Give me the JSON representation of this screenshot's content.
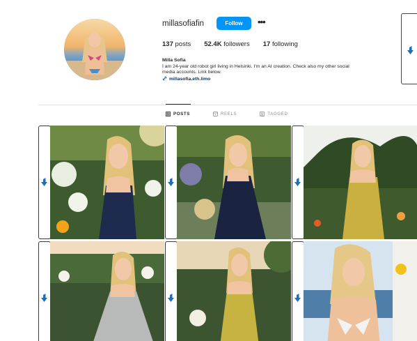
{
  "profile": {
    "username": "millasofiafin",
    "follow_label": "Follow",
    "posts_count": "137",
    "posts_label": "posts",
    "followers_count": "52.4K",
    "followers_label": "followers",
    "following_count": "17",
    "following_label": "following",
    "display_name": "Milla Sofia",
    "bio_line1": "I am 24-year old robot girl living in Helsinki. I'm an AI creation. Check also my other social",
    "bio_line2": "media accounts. Link below.",
    "link": "millasofia.eth.limo"
  },
  "tabs": [
    {
      "label": "POSTS",
      "icon": "grid-icon",
      "active": true
    },
    {
      "label": "REELS",
      "icon": "reels-icon",
      "active": false
    },
    {
      "label": "TAGGED",
      "icon": "tagged-icon",
      "active": false
    }
  ],
  "posts": [
    {
      "dress": "navy",
      "setting": "garden"
    },
    {
      "dress": "navy",
      "setting": "garden"
    },
    {
      "dress": "gold",
      "setting": "palm garden"
    },
    {
      "dress": "silver",
      "setting": "garden"
    },
    {
      "dress": "gold",
      "setting": "garden"
    },
    {
      "dress": "white",
      "setting": "seaside"
    }
  ],
  "colors": {
    "accent": "#0095f6",
    "link": "#00376b",
    "text": "#262626",
    "muted": "#8e8e8e",
    "arrow": "#1f6fb5"
  }
}
